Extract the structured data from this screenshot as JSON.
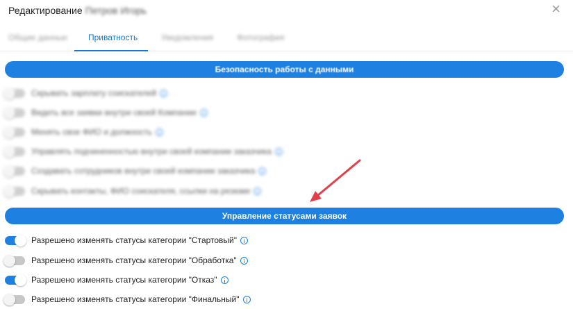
{
  "header": {
    "title": "Редактирование",
    "user_name": "Петров Игорь",
    "close_label": "×"
  },
  "tabs": [
    {
      "label": "Общие данные",
      "active": false
    },
    {
      "label": "Приватность",
      "active": true
    },
    {
      "label": "Уведомления",
      "active": false
    },
    {
      "label": "Фотография",
      "active": false
    }
  ],
  "sections": {
    "data_security": {
      "title": "Безопасность работы с данными",
      "items": [
        {
          "label": "Скрывать зарплату соискателей",
          "enabled": false
        },
        {
          "label": "Видеть все заявки внутри своей Компании",
          "enabled": false
        },
        {
          "label": "Менять свое ФИО и должность",
          "enabled": false
        },
        {
          "label": "Управлять подчиненностью внутри своей компании заказчика",
          "enabled": false
        },
        {
          "label": "Создавать сотрудников внутри своей компании заказчика",
          "enabled": false
        },
        {
          "label": "Скрывать контакты, ФИО соискателя, ссылки на резюме",
          "enabled": false
        }
      ]
    },
    "status_management": {
      "title": "Управление статусами заявок",
      "items": [
        {
          "label": "Разрешено изменять статусы категории \"Стартовый\"",
          "enabled": true
        },
        {
          "label": "Разрешено изменять статусы категории \"Обработка\"",
          "enabled": false
        },
        {
          "label": "Разрешено изменять статусы категории \"Отказ\"",
          "enabled": true
        },
        {
          "label": "Разрешено изменять статусы категории \"Финальный\"",
          "enabled": false
        }
      ]
    }
  },
  "colors": {
    "accent": "#1e80e0",
    "annotation_arrow": "#e0404a"
  }
}
